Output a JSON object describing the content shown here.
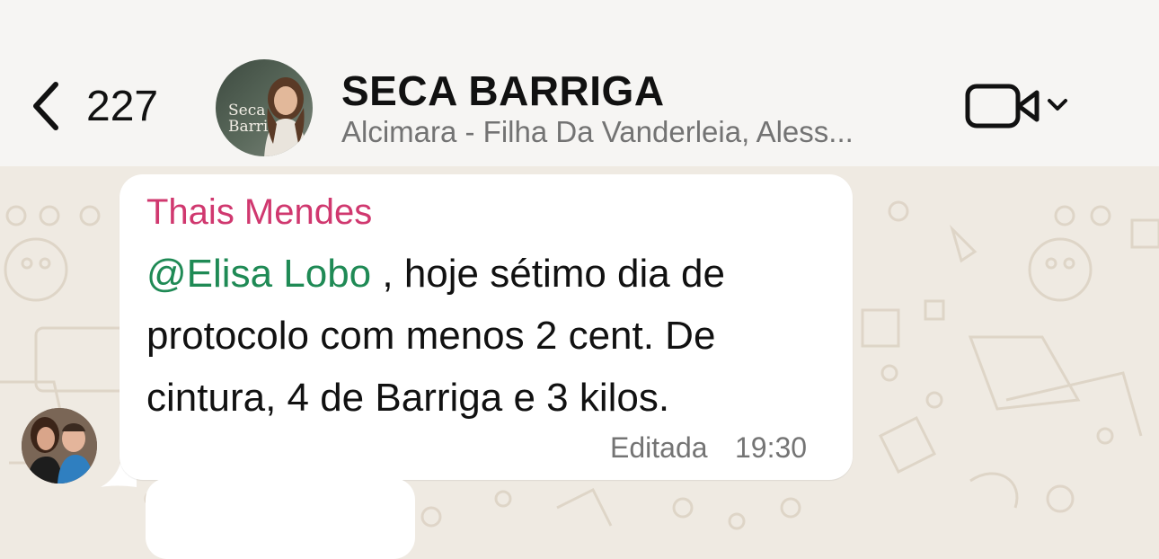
{
  "header": {
    "back_count": "227",
    "group_name": "SECA BARRIGA",
    "members_preview": "Alcimara - Filha Da Vanderleia, Aless...",
    "avatar_text": "Seca Barriga",
    "icons": {
      "back": "chevron-left-icon",
      "video": "video-camera-icon",
      "dropdown": "chevron-down-icon"
    }
  },
  "message": {
    "sender": "Thais Mendes",
    "mention": "@Elisa Lobo",
    "text_after_mention": " , hoje sétimo dia de protocolo com menos 2 cent. De cintura, 4 de Barriga e 3 kilos.",
    "edited_label": "Editada",
    "time": "19:30"
  },
  "colors": {
    "sender_name": "#d0386f",
    "mention": "#1f8a55",
    "background": "#efeae2",
    "bubble": "#ffffff"
  }
}
